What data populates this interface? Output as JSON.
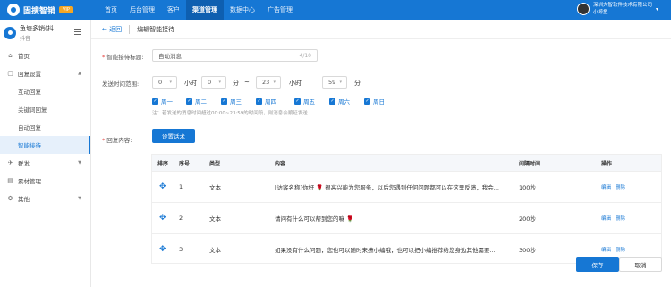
{
  "topbar": {
    "logo_text": "固搜智销",
    "vip": "VIP",
    "nav": [
      {
        "label": "首页"
      },
      {
        "label": "后台管理"
      },
      {
        "label": "客户"
      },
      {
        "label": "渠道管理"
      },
      {
        "label": "数据中心"
      },
      {
        "label": "广告管理"
      }
    ],
    "user_company": "深圳大智软件技术有限公司",
    "user_name": "小鲸鱼"
  },
  "sidebar": {
    "shop_name": "鱼塘多销(抖...",
    "shop_platform": "抖音",
    "items": [
      {
        "label": "首页",
        "icon": "home-icon"
      },
      {
        "label": "回复设置",
        "icon": "chat-icon"
      },
      {
        "label": "互动回复"
      },
      {
        "label": "关键词回复"
      },
      {
        "label": "自动回复"
      },
      {
        "label": "智能接待"
      },
      {
        "label": "群发",
        "icon": "send-icon"
      },
      {
        "label": "素材管理",
        "icon": "folder-icon"
      },
      {
        "label": "其他",
        "icon": "gear-icon"
      }
    ]
  },
  "breadcrumb": {
    "back": "返回",
    "title": "编辑智能接待"
  },
  "form": {
    "title_label": "智能接待标题:",
    "title_value": "自动消息",
    "title_count": "4/10",
    "time_label": "发送时间范围:",
    "start_hour": "0",
    "start_min": "0",
    "end_hour": "23",
    "end_min": "59",
    "hour_unit": "小时",
    "min_unit": "分",
    "range_sep": "~",
    "weekdays": [
      "周一",
      "周二",
      "周三",
      "周四",
      "周五",
      "周六",
      "周日"
    ],
    "hint": "注：若发送的消息时间超过00:00~23:59的时间段，则消息会顺延发送",
    "reply_label": "回复内容:",
    "script_button": "设置话术"
  },
  "table": {
    "headers": [
      "排序",
      "序号",
      "类型",
      "内容",
      "间隔时间",
      "操作"
    ],
    "rows": [
      {
        "index": "1",
        "type": "文本",
        "content": "[访客名称]你好 🌹 很高兴能为您服务，以后您遇到任何问题都可以在这里反馈，我会...",
        "interval": "100秒"
      },
      {
        "index": "2",
        "type": "文本",
        "content": "请问有什么可以帮到您的嘛 🌹",
        "interval": "200秒"
      },
      {
        "index": "3",
        "type": "文本",
        "content": "如果没有什么问题，您也可以随时来撩小编哦，也可以把小编推荐给您身边其他需要...",
        "interval": "300秒"
      }
    ],
    "edit_label": "编辑",
    "delete_label": "删除"
  },
  "footer": {
    "save": "保存",
    "cancel": "取消"
  },
  "colors": {
    "primary": "#1677d4",
    "topbar": "#1677d4",
    "required": "#e53935"
  }
}
